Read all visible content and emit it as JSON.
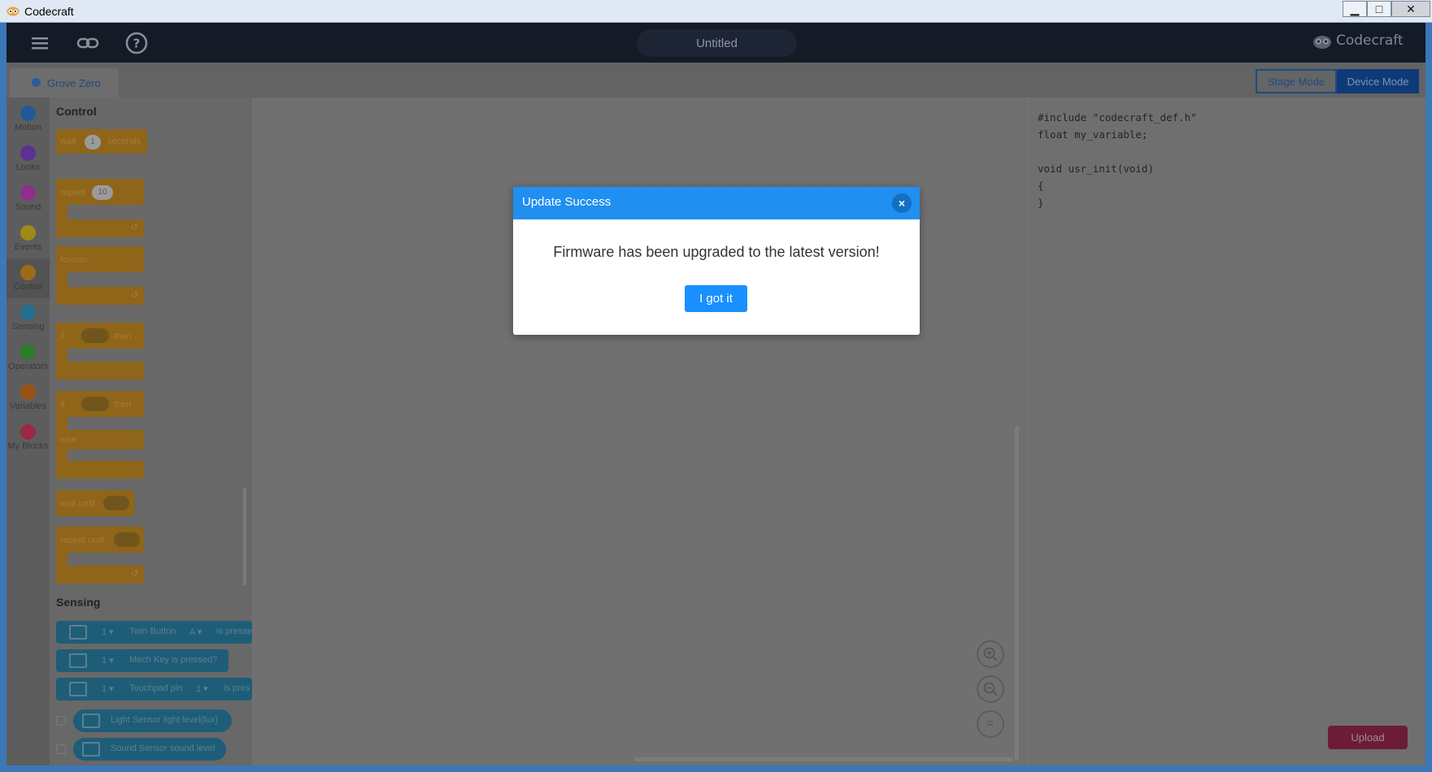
{
  "window": {
    "title": "Codecraft",
    "controls": [
      "minimize",
      "maximize",
      "close"
    ]
  },
  "header": {
    "project_name": "Untitled",
    "brand": "Codecraft"
  },
  "device_tab": {
    "label": "Grove Zero"
  },
  "modes": {
    "stage": "Stage Mode",
    "device": "Device Mode"
  },
  "categories": [
    {
      "label": "Motion",
      "color": "#1f5a96"
    },
    {
      "label": "Looks",
      "color": "#5b3294"
    },
    {
      "label": "Sound",
      "color": "#8d2f8c"
    },
    {
      "label": "Events",
      "color": "#9e8a15"
    },
    {
      "label": "Control",
      "color": "#9c6a17"
    },
    {
      "label": "Sensing",
      "color": "#256f91"
    },
    {
      "label": "Operators",
      "color": "#2c7a2c"
    },
    {
      "label": "Variables",
      "color": "#9a5214"
    },
    {
      "label": "My Blocks",
      "color": "#9a2a45"
    }
  ],
  "palette": {
    "control_title": "Control",
    "wait": {
      "label": "wait",
      "value": "1",
      "suffix": "seconds"
    },
    "repeat": {
      "label": "repeat",
      "value": "10"
    },
    "forever": "forever",
    "if_then": {
      "if": "if",
      "then": "then"
    },
    "if_else": {
      "if": "if",
      "then": "then",
      "else": "else"
    },
    "wait_until": "wait until",
    "repeat_until": "repeat until",
    "sensing_title": "Sensing",
    "sensing_blocks": [
      {
        "port": "1 ▾",
        "text": "Twin Button",
        "option": "A ▾",
        "suffix": "is presse"
      },
      {
        "port": "1 ▾",
        "text": "Mech Key is pressed?"
      },
      {
        "port": "1 ▾",
        "text": "Touchpad pin",
        "option": "1 ▾",
        "suffix": "is pres"
      },
      {
        "text": "Light Sensor light level(lux)"
      },
      {
        "text": "Sound Sensor sound level"
      }
    ]
  },
  "code": {
    "lines": "#include \"codecraft_def.h\"\nfloat my_variable;\n\nvoid usr_init(void)\n{\n}",
    "upload_label": "Upload"
  },
  "zoom": {
    "in": "zoom-in",
    "out": "zoom-out",
    "reset": "="
  },
  "modal": {
    "title": "Update Success",
    "message": "Firmware has been upgraded to the latest version!",
    "button": "I got it",
    "close": "×"
  }
}
